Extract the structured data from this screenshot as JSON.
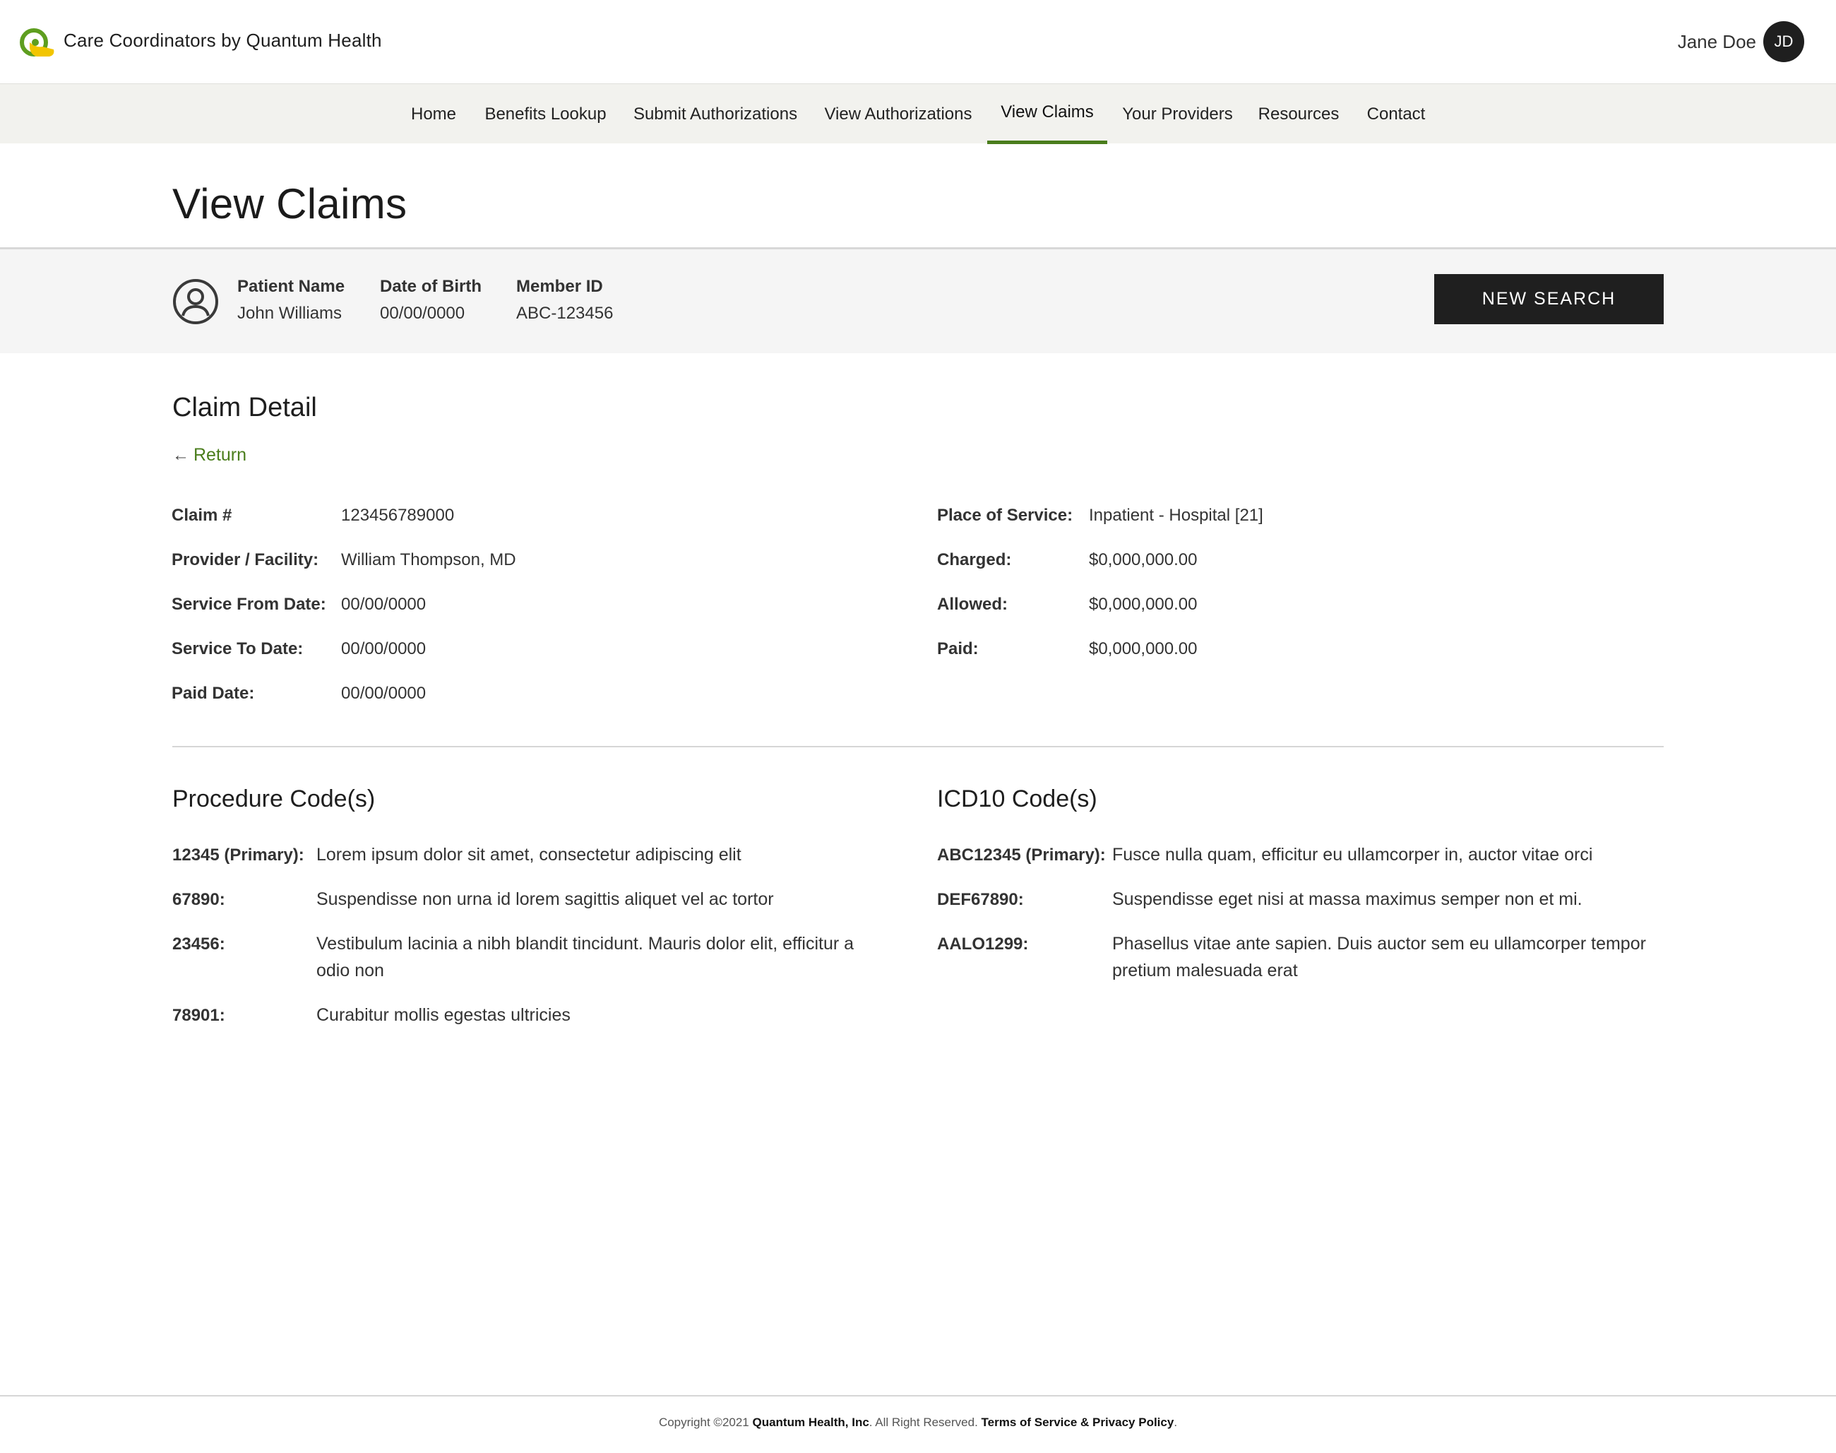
{
  "header": {
    "brand": "Care Coordinators by Quantum Health",
    "user_name": "Jane Doe",
    "user_initials": "JD",
    "colors": {
      "accent": "#4a7d1c",
      "logo_green": "#5e9e1f",
      "logo_yellow": "#f2c500"
    }
  },
  "nav": {
    "items": [
      "Home",
      "Benefits Lookup",
      "Submit Authorizations",
      "View Authorizations",
      "View Claims",
      "Your Providers",
      "Resources",
      "Contact"
    ],
    "active": "View Claims"
  },
  "page": {
    "title": "View Claims"
  },
  "patient": {
    "name_label": "Patient Name",
    "name": "John Williams",
    "dob_label": "Date of Birth",
    "dob": "00/00/0000",
    "member_label": "Member ID",
    "member_id": "ABC-123456",
    "new_search_label": "NEW SEARCH"
  },
  "claim": {
    "title": "Claim Detail",
    "return_label": "Return",
    "left": [
      {
        "label": "Claim #",
        "value": "123456789000"
      },
      {
        "label": "Provider / Facility:",
        "value": "William Thompson, MD"
      },
      {
        "label": "Service From Date:",
        "value": "00/00/0000"
      },
      {
        "label": "Service To Date:",
        "value": "00/00/0000"
      },
      {
        "label": "Paid Date:",
        "value": "00/00/0000"
      }
    ],
    "right": [
      {
        "label": "Place of Service:",
        "value": "Inpatient - Hospital [21]"
      },
      {
        "label": "Charged:",
        "value": "$0,000,000.00"
      },
      {
        "label": "Allowed:",
        "value": "$0,000,000.00"
      },
      {
        "label": "Paid:",
        "value": "$0,000,000.00"
      }
    ]
  },
  "procedures": {
    "title": "Procedure Code(s)",
    "items": [
      {
        "code": "12345 (Primary):",
        "desc": "Lorem ipsum dolor sit amet, consectetur adipiscing elit"
      },
      {
        "code": "67890:",
        "desc": "Suspendisse non urna id lorem sagittis aliquet vel ac tortor"
      },
      {
        "code": "23456:",
        "desc_line1": "Vestibulum lacinia a nibh blandit tincidunt. Mauris dolor elit, efficitur a",
        "desc_line2": "odio non"
      },
      {
        "code": "78901:",
        "desc": "Curabitur mollis egestas ultricies"
      }
    ]
  },
  "icd10": {
    "title": "ICD10 Code(s)",
    "items": [
      {
        "code": "ABC12345 (Primary):",
        "desc": "Fusce nulla quam, efficitur eu ullamcorper in, auctor vitae orci"
      },
      {
        "code": "DEF67890:",
        "desc": "Suspendisse eget nisi at massa maximus semper non et mi."
      },
      {
        "code": "AALO1299:",
        "desc_line1": "Phasellus vitae ante sapien. Duis auctor sem eu ullamcorper tempor",
        "desc_line2": "pretium malesuada erat"
      }
    ]
  },
  "footer": {
    "prefix": "Copyright ©2021 ",
    "company": "Quantum Health, Inc",
    "middle": ". All Right Reserved. ",
    "links": "Terms of Service & Privacy Policy",
    "suffix": "."
  }
}
